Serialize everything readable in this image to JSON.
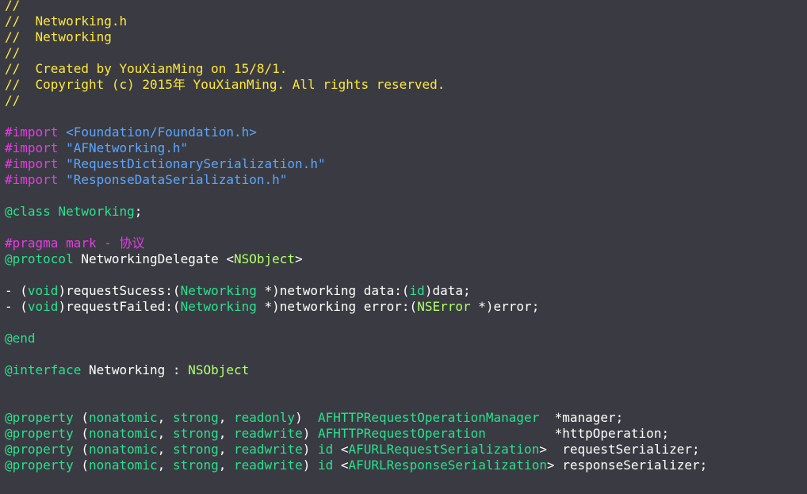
{
  "editor": {
    "file_name": "Networking.h",
    "language": "Objective-C",
    "theme_colors": {
      "background": "#3a3b42",
      "comment": "#ffe83a",
      "directive": "#e33ce2",
      "string": "#5aa5ff",
      "keyword": "#29e08f",
      "type": "#b0ff6c",
      "plain": "#ffffff"
    }
  },
  "code_lines": [
    [
      {
        "t": "//",
        "c": "comment"
      }
    ],
    [
      {
        "t": "//  Networking.h",
        "c": "comment"
      }
    ],
    [
      {
        "t": "//  Networking",
        "c": "comment"
      }
    ],
    [
      {
        "t": "//",
        "c": "comment"
      }
    ],
    [
      {
        "t": "//  Created by YouXianMing on 15/8/1.",
        "c": "comment"
      }
    ],
    [
      {
        "t": "//  Copyright (c) 2015年 YouXianMing. All rights reserved.",
        "c": "comment"
      }
    ],
    [
      {
        "t": "//",
        "c": "comment"
      }
    ],
    [],
    [
      {
        "t": "#import ",
        "c": "directive"
      },
      {
        "t": "<Foundation/Foundation.h>",
        "c": "string"
      }
    ],
    [
      {
        "t": "#import ",
        "c": "directive"
      },
      {
        "t": "\"AFNetworking.h\"",
        "c": "string"
      }
    ],
    [
      {
        "t": "#import ",
        "c": "directive"
      },
      {
        "t": "\"RequestDictionarySerialization.h\"",
        "c": "string"
      }
    ],
    [
      {
        "t": "#import ",
        "c": "directive"
      },
      {
        "t": "\"ResponseDataSerialization.h\"",
        "c": "string"
      }
    ],
    [],
    [
      {
        "t": "@class",
        "c": "keyword"
      },
      {
        "t": " ",
        "c": "plain"
      },
      {
        "t": "Networking",
        "c": "type"
      },
      {
        "t": ";",
        "c": "plain"
      }
    ],
    [],
    [
      {
        "t": "#pragma mark - 协议",
        "c": "directive"
      }
    ],
    [
      {
        "t": "@protocol",
        "c": "keyword"
      },
      {
        "t": " NetworkingDelegate <",
        "c": "plain"
      },
      {
        "t": "NSObject",
        "c": "type2"
      },
      {
        "t": ">",
        "c": "plain"
      }
    ],
    [],
    [
      {
        "t": "- (",
        "c": "plain"
      },
      {
        "t": "void",
        "c": "keyword"
      },
      {
        "t": ")requestSucess:(",
        "c": "plain"
      },
      {
        "t": "Networking",
        "c": "type"
      },
      {
        "t": " *)networking data:(",
        "c": "plain"
      },
      {
        "t": "id",
        "c": "keyword"
      },
      {
        "t": ")data;",
        "c": "plain"
      }
    ],
    [
      {
        "t": "- (",
        "c": "plain"
      },
      {
        "t": "void",
        "c": "keyword"
      },
      {
        "t": ")requestFailed:(",
        "c": "plain"
      },
      {
        "t": "Networking",
        "c": "type"
      },
      {
        "t": " *)networking error:(",
        "c": "plain"
      },
      {
        "t": "NSError",
        "c": "type2"
      },
      {
        "t": " *)error;",
        "c": "plain"
      }
    ],
    [],
    [
      {
        "t": "@end",
        "c": "keyword"
      }
    ],
    [],
    [
      {
        "t": "@interface",
        "c": "keyword"
      },
      {
        "t": " Networking : ",
        "c": "plain"
      },
      {
        "t": "NSObject",
        "c": "type2"
      }
    ],
    [],
    [],
    [
      {
        "t": "@property",
        "c": "keyword"
      },
      {
        "t": " (",
        "c": "plain"
      },
      {
        "t": "nonatomic",
        "c": "keyword"
      },
      {
        "t": ", ",
        "c": "plain"
      },
      {
        "t": "strong",
        "c": "keyword"
      },
      {
        "t": ", ",
        "c": "plain"
      },
      {
        "t": "readonly",
        "c": "keyword"
      },
      {
        "t": ")  ",
        "c": "plain"
      },
      {
        "t": "AFHTTPRequestOperationManager",
        "c": "type"
      },
      {
        "t": "  *manager;",
        "c": "plain"
      }
    ],
    [
      {
        "t": "@property",
        "c": "keyword"
      },
      {
        "t": " (",
        "c": "plain"
      },
      {
        "t": "nonatomic",
        "c": "keyword"
      },
      {
        "t": ", ",
        "c": "plain"
      },
      {
        "t": "strong",
        "c": "keyword"
      },
      {
        "t": ", ",
        "c": "plain"
      },
      {
        "t": "readwrite",
        "c": "keyword"
      },
      {
        "t": ") ",
        "c": "plain"
      },
      {
        "t": "AFHTTPRequestOperation",
        "c": "type"
      },
      {
        "t": "         *httpOperation;",
        "c": "plain"
      }
    ],
    [
      {
        "t": "@property",
        "c": "keyword"
      },
      {
        "t": " (",
        "c": "plain"
      },
      {
        "t": "nonatomic",
        "c": "keyword"
      },
      {
        "t": ", ",
        "c": "plain"
      },
      {
        "t": "strong",
        "c": "keyword"
      },
      {
        "t": ", ",
        "c": "plain"
      },
      {
        "t": "readwrite",
        "c": "keyword"
      },
      {
        "t": ") ",
        "c": "plain"
      },
      {
        "t": "id",
        "c": "keyword"
      },
      {
        "t": " <",
        "c": "plain"
      },
      {
        "t": "AFURLRequestSerialization",
        "c": "type"
      },
      {
        "t": ">  requestSerializer;",
        "c": "plain"
      }
    ],
    [
      {
        "t": "@property",
        "c": "keyword"
      },
      {
        "t": " (",
        "c": "plain"
      },
      {
        "t": "nonatomic",
        "c": "keyword"
      },
      {
        "t": ", ",
        "c": "plain"
      },
      {
        "t": "strong",
        "c": "keyword"
      },
      {
        "t": ", ",
        "c": "plain"
      },
      {
        "t": "readwrite",
        "c": "keyword"
      },
      {
        "t": ") ",
        "c": "plain"
      },
      {
        "t": "id",
        "c": "keyword"
      },
      {
        "t": " <",
        "c": "plain"
      },
      {
        "t": "AFURLResponseSerialization",
        "c": "type"
      },
      {
        "t": "> responseSerializer;",
        "c": "plain"
      }
    ]
  ]
}
